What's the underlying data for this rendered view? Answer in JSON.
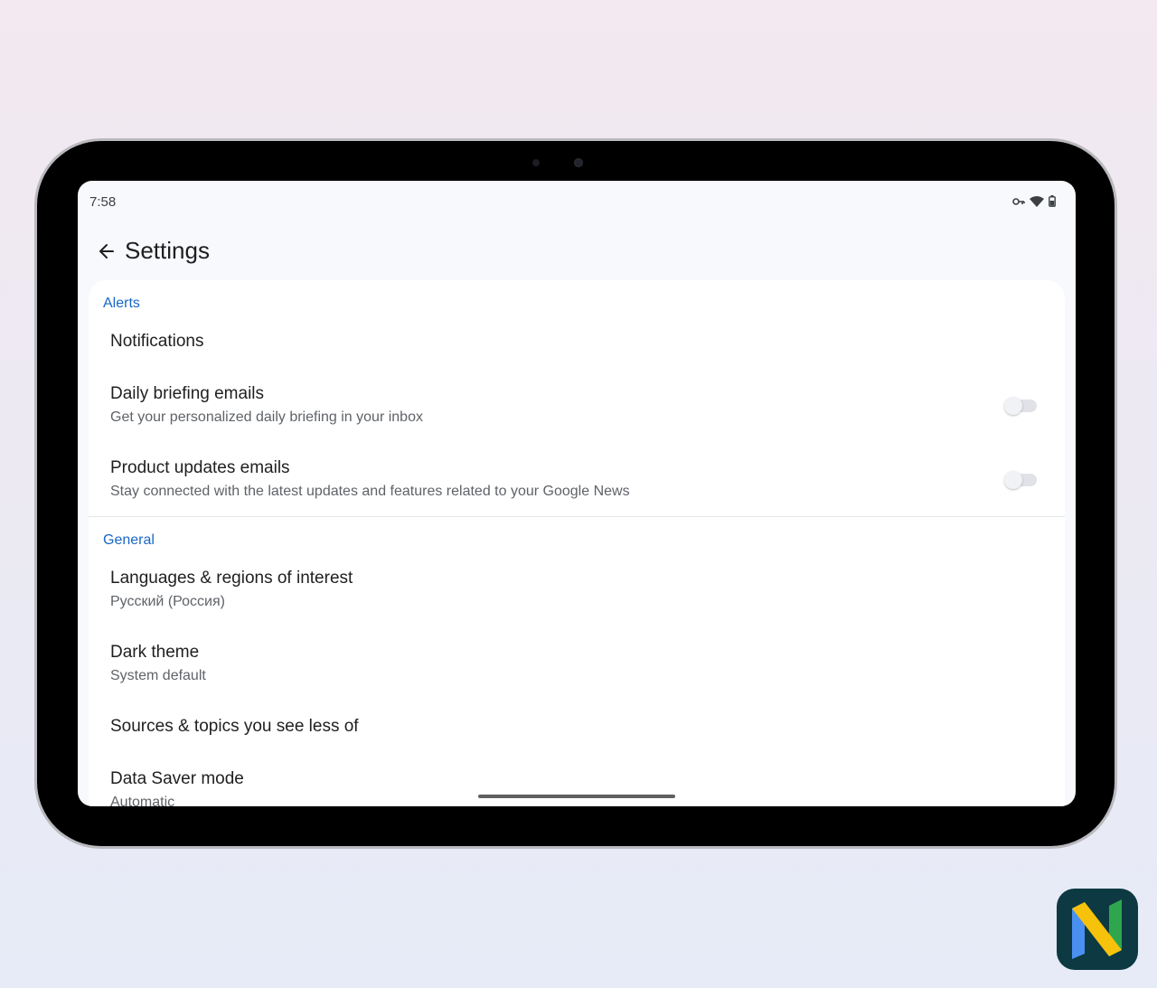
{
  "status_bar": {
    "time": "7:58",
    "icons": [
      "key-icon",
      "wifi-icon",
      "battery-icon"
    ]
  },
  "header": {
    "back_icon": "arrow-back-icon",
    "title": "Settings"
  },
  "sections": [
    {
      "header": "Alerts",
      "items": [
        {
          "title": "Notifications"
        },
        {
          "title": "Daily briefing emails",
          "subtitle": "Get your personalized daily briefing in your inbox",
          "toggle": false
        },
        {
          "title": "Product updates emails",
          "subtitle": "Stay connected with the latest updates and features related to your Google News",
          "toggle": false
        }
      ]
    },
    {
      "header": "General",
      "items": [
        {
          "title": "Languages & regions of interest",
          "subtitle": "Русский (Россия)"
        },
        {
          "title": "Dark theme",
          "subtitle": "System default"
        },
        {
          "title": "Sources & topics you see less of"
        },
        {
          "title": "Data Saver mode",
          "subtitle": "Automatic"
        }
      ]
    }
  ],
  "colors": {
    "accent": "#1a67c6",
    "screen_background": "#f8f9fd",
    "card_background": "#ffffff",
    "logo_background": "#0c3942",
    "logo_blue": "#4a90f0",
    "logo_yellow": "#f6c20b",
    "logo_green": "#2fa64e"
  },
  "branding": {
    "logo_icon": "google-news-n-logo-icon"
  }
}
